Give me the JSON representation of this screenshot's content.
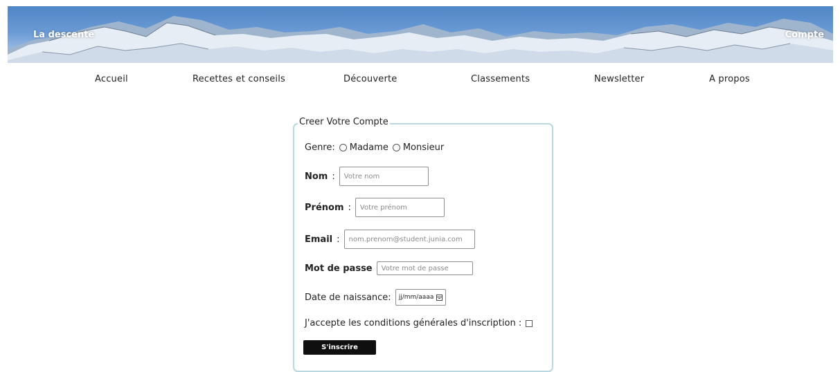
{
  "top_strip": {
    "text": ""
  },
  "banner": {
    "left_link": "La descente",
    "right_link": "Compte"
  },
  "nav": {
    "items": [
      {
        "label": "Accueil"
      },
      {
        "label": "Recettes et conseils"
      },
      {
        "label": "Découverte"
      },
      {
        "label": "Classements"
      },
      {
        "label": "Newsletter"
      },
      {
        "label": "A propos"
      }
    ]
  },
  "form": {
    "legend": "Creer Votre Compte",
    "genre": {
      "label": "Genre:",
      "option_1": "Madame",
      "option_2": "Monsieur"
    },
    "nom": {
      "label": "Nom",
      "separator": ":",
      "placeholder": "Votre nom"
    },
    "prenom": {
      "label": "Prénom",
      "separator": ":",
      "placeholder": "Votre prénom"
    },
    "email": {
      "label": "Email",
      "separator": ":",
      "placeholder": "nom.prenom@student.junia.com"
    },
    "password": {
      "label": "Mot de passe",
      "placeholder": "Votre mot de passe"
    },
    "birthdate": {
      "label": "Date de naissance:",
      "placeholder": "jj/mm/aaaa"
    },
    "terms": {
      "label": "J'accepte les conditions générales d'inscription :"
    },
    "submit_label": "S'inscrire"
  },
  "colors": {
    "fieldset_border": "#b9d8e0",
    "button_bg": "#0f0f0f",
    "banner_sky": "#5a8fcc"
  }
}
